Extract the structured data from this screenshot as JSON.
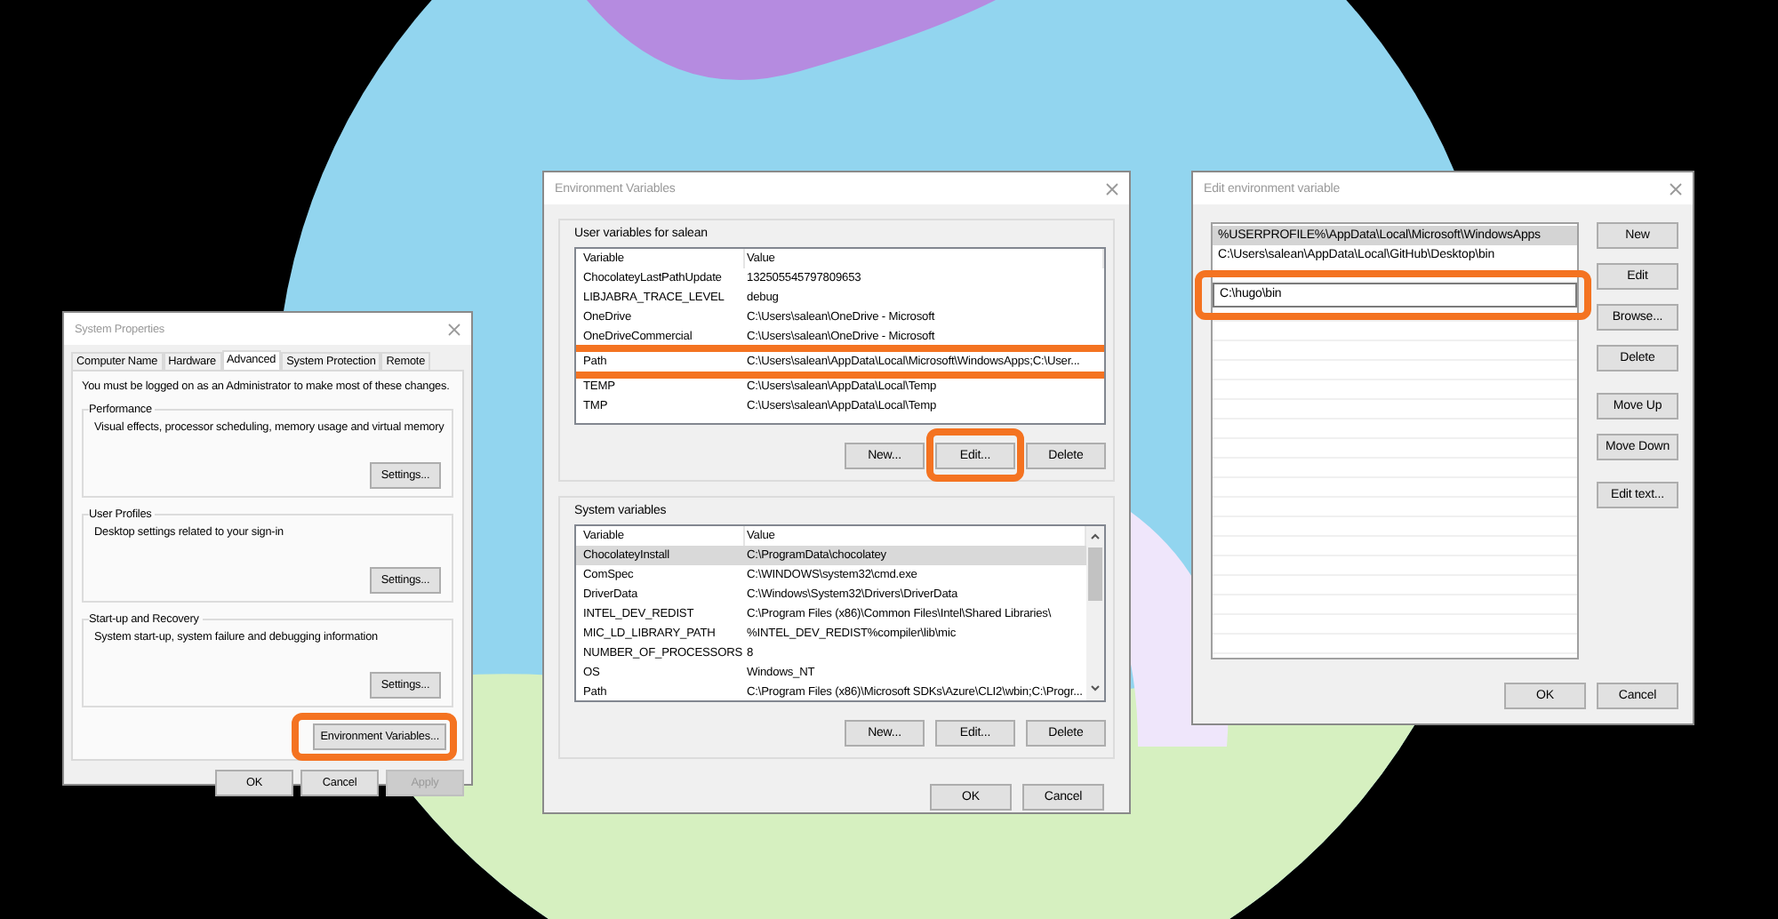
{
  "system_properties": {
    "title": "System Properties",
    "tabs": [
      {
        "label": "Computer Name",
        "selected": false
      },
      {
        "label": "Hardware",
        "selected": false
      },
      {
        "label": "Advanced",
        "selected": true
      },
      {
        "label": "System Protection",
        "selected": false
      },
      {
        "label": "Remote",
        "selected": false
      }
    ],
    "notice": "You must be logged on as an Administrator to make most of these changes.",
    "groups": [
      {
        "label": "Performance",
        "description": "Visual effects, processor scheduling, memory usage and virtual memory",
        "button": "Settings..."
      },
      {
        "label": "User Profiles",
        "description": "Desktop settings related to your sign-in",
        "button": "Settings..."
      },
      {
        "label": "Start-up and Recovery",
        "description": "System start-up, system failure and debugging information",
        "button": "Settings..."
      }
    ],
    "env_button": {
      "label": "Environment Variables...",
      "highlighted": true
    },
    "buttons": [
      {
        "label": "OK",
        "disabled": false
      },
      {
        "label": "Cancel",
        "disabled": false
      },
      {
        "label": "Apply",
        "disabled": true
      }
    ]
  },
  "environment_variables": {
    "title": "Environment Variables",
    "sections": [
      {
        "label": "User variables for salean",
        "columns": [
          "Variable",
          "Value"
        ],
        "scrollbar": false,
        "rows": [
          {
            "cells": [
              "ChocolateyLastPathUpdate",
              "132505545797809653"
            ],
            "selected": false,
            "highlighted": false
          },
          {
            "cells": [
              "LIBJABRA_TRACE_LEVEL",
              "debug"
            ],
            "selected": false,
            "highlighted": false
          },
          {
            "cells": [
              "OneDrive",
              "C:\\Users\\salean\\OneDrive - Microsoft"
            ],
            "selected": false,
            "highlighted": false
          },
          {
            "cells": [
              "OneDriveCommercial",
              "C:\\Users\\salean\\OneDrive - Microsoft"
            ],
            "selected": false,
            "highlighted": false
          },
          {
            "cells": [
              "Path",
              "C:\\Users\\salean\\AppData\\Local\\Microsoft\\WindowsApps;C:\\User..."
            ],
            "selected": false,
            "highlighted": true
          },
          {
            "cells": [
              "TEMP",
              "C:\\Users\\salean\\AppData\\Local\\Temp"
            ],
            "selected": false,
            "highlighted": false
          },
          {
            "cells": [
              "TMP",
              "C:\\Users\\salean\\AppData\\Local\\Temp"
            ],
            "selected": false,
            "highlighted": false
          }
        ],
        "buttons": [
          {
            "label": "New...",
            "highlighted": false
          },
          {
            "label": "Edit...",
            "highlighted": true
          },
          {
            "label": "Delete",
            "highlighted": false
          }
        ]
      },
      {
        "label": "System variables",
        "columns": [
          "Variable",
          "Value"
        ],
        "scrollbar": true,
        "rows": [
          {
            "cells": [
              "ChocolateyInstall",
              "C:\\ProgramData\\chocolatey"
            ],
            "selected": true,
            "highlighted": false
          },
          {
            "cells": [
              "ComSpec",
              "C:\\WINDOWS\\system32\\cmd.exe"
            ],
            "selected": false,
            "highlighted": false
          },
          {
            "cells": [
              "DriverData",
              "C:\\Windows\\System32\\Drivers\\DriverData"
            ],
            "selected": false,
            "highlighted": false
          },
          {
            "cells": [
              "INTEL_DEV_REDIST",
              "C:\\Program Files (x86)\\Common Files\\Intel\\Shared Libraries\\"
            ],
            "selected": false,
            "highlighted": false
          },
          {
            "cells": [
              "MIC_LD_LIBRARY_PATH",
              "%INTEL_DEV_REDIST%compiler\\lib\\mic"
            ],
            "selected": false,
            "highlighted": false
          },
          {
            "cells": [
              "NUMBER_OF_PROCESSORS",
              "8"
            ],
            "selected": false,
            "highlighted": false
          },
          {
            "cells": [
              "OS",
              "Windows_NT"
            ],
            "selected": false,
            "highlighted": false
          },
          {
            "cells": [
              "Path",
              "C:\\Program Files (x86)\\Microsoft SDKs\\Azure\\CLI2\\wbin;C:\\Progr..."
            ],
            "selected": false,
            "highlighted": false
          }
        ],
        "buttons": [
          {
            "label": "New...",
            "highlighted": false
          },
          {
            "label": "Edit...",
            "highlighted": false
          },
          {
            "label": "Delete",
            "highlighted": false
          }
        ]
      }
    ],
    "buttons": [
      "OK",
      "Cancel"
    ]
  },
  "edit_variable": {
    "title": "Edit environment variable",
    "entries": [
      {
        "text": "%USERPROFILE%\\AppData\\Local\\Microsoft\\WindowsApps",
        "kind": "item",
        "selected": true,
        "highlighted": false
      },
      {
        "text": "C:\\Users\\salean\\AppData\\Local\\GitHub\\Desktop\\bin",
        "kind": "item",
        "selected": false,
        "highlighted": false
      },
      {
        "text": "C:\\hugo\\bin",
        "kind": "editing",
        "selected": false,
        "highlighted": true
      }
    ],
    "button_groups": [
      [
        "New",
        "Edit",
        "Browse...",
        "Delete"
      ],
      [
        "Move Up",
        "Move Down"
      ],
      [
        "Edit text..."
      ]
    ],
    "buttons": [
      "OK",
      "Cancel"
    ]
  }
}
